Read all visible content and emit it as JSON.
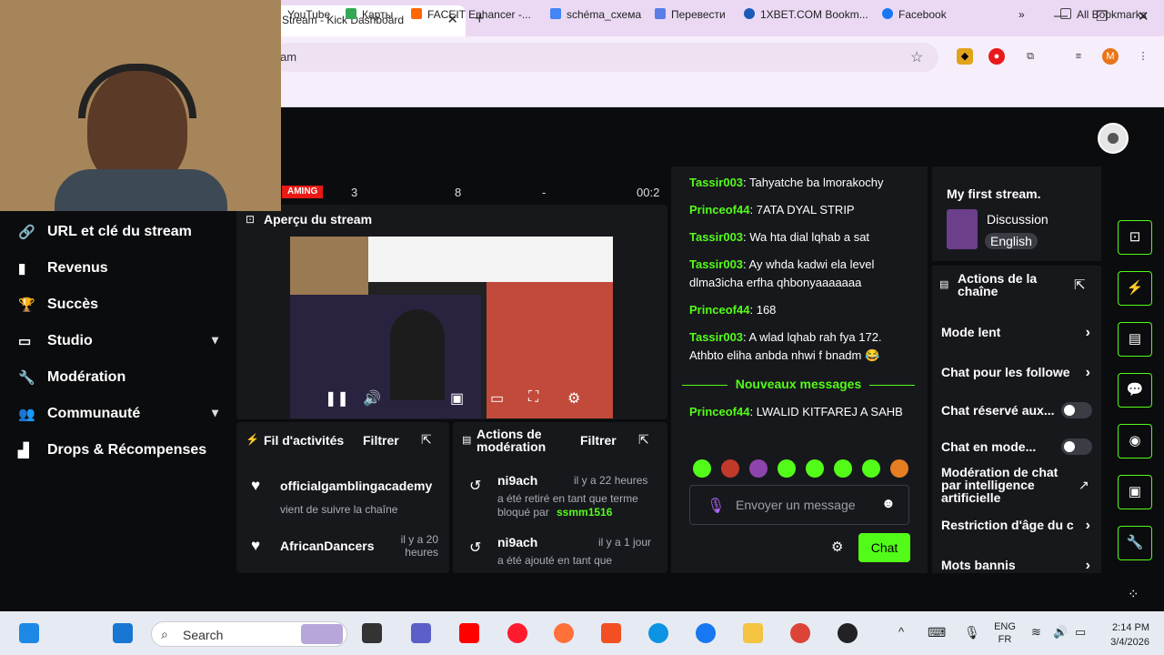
{
  "browser": {
    "tab_title": "Stream - Kick Dashboard",
    "address": "am",
    "profile_initial": "M",
    "bookmarks": [
      "YouTube",
      "Карты",
      "FACEIT Enhancer -...",
      "schéma_схема",
      "Перевести",
      "1XBET.COM Bookm...",
      "Facebook"
    ],
    "all_bookmarks": "All Bookmarks"
  },
  "stats": {
    "live": "AMING",
    "viewers": "3",
    "followers": "8",
    "subs": "-",
    "uptime": "00:2"
  },
  "sidebar": {
    "items": [
      {
        "label": "URL et clé du stream",
        "icon": "link-icon"
      },
      {
        "label": "Revenus",
        "icon": "chart-icon"
      },
      {
        "label": "Succès",
        "icon": "trophy-icon"
      },
      {
        "label": "Studio",
        "icon": "studio-icon"
      },
      {
        "label": "Modération",
        "icon": "wrench-icon"
      },
      {
        "label": "Communauté",
        "icon": "community-icon"
      },
      {
        "label": "Drops & Récompenses",
        "icon": "drops-icon"
      }
    ]
  },
  "preview": {
    "title": "Aperçu du stream"
  },
  "activity": {
    "title": "Fil d'activités",
    "filter": "Filtrer",
    "items": [
      {
        "user": "officialgamblingacademy",
        "text": "vient de suivre la chaîne",
        "time": ""
      },
      {
        "user": "AfricanDancers",
        "text": "",
        "time": "il y a 20 heures"
      }
    ]
  },
  "modactions": {
    "title": "Actions de modération",
    "filter": "Filtrer",
    "items": [
      {
        "user": "ni9ach",
        "time": "il y a 22 heures",
        "text": "a été retiré en tant que terme bloqué par",
        "by": "ssmm1516"
      },
      {
        "user": "ni9ach",
        "time": "il y a 1 jour",
        "text": "a été ajouté en tant que",
        "by": ""
      }
    ]
  },
  "chat": {
    "messages": [
      {
        "user": "Tassir003",
        "text": "Tahyatche ba lmorakochy"
      },
      {
        "user": "Princeof44",
        "text": "7ATA DYAL STRIP"
      },
      {
        "user": "Tassir003",
        "text": "Wa hta dial lqhab a sat"
      },
      {
        "user": "Tassir003",
        "text": "Ay whda kadwi ela level dlma3icha erfha qhbonyaaaaaaa"
      },
      {
        "user": "Princeof44",
        "text": "168"
      },
      {
        "user": "Tassir003",
        "text": "A wlad lqhab rah fya 172. Athbto eliha anbda nhwi f bnadm 😂"
      }
    ],
    "new_messages": "Nouveaux messages",
    "new": [
      {
        "user": "Princeof44",
        "text": "LWALID KITFAREJ A SAHB"
      }
    ],
    "placeholder": "Envoyer un message",
    "send": "Chat"
  },
  "info": {
    "title": "My first stream.",
    "category": "Discussion",
    "language": "English"
  },
  "actions": {
    "title": "Actions de la chaîne",
    "rows": [
      {
        "label": "Mode lent",
        "type": "arrow"
      },
      {
        "label": "Chat pour les followe",
        "type": "arrow"
      },
      {
        "label": "Chat réservé aux...",
        "type": "toggle",
        "on": false
      },
      {
        "label": "Chat en mode...",
        "type": "toggle",
        "on": false
      },
      {
        "label": "Modération de chat par intelligence artificielle",
        "type": "external"
      },
      {
        "label": "Restriction d'âge du c",
        "type": "arrow"
      },
      {
        "label": "Mots bannis",
        "type": "arrow"
      }
    ]
  },
  "taskbar": {
    "search": "Search",
    "lang1": "ENG",
    "lang2": "FR",
    "time": "2:14 PM",
    "date": "3/4/2026"
  },
  "colors": {
    "accent": "#53fc18",
    "bg": "#0b0c0e",
    "panel": "#17181c"
  }
}
